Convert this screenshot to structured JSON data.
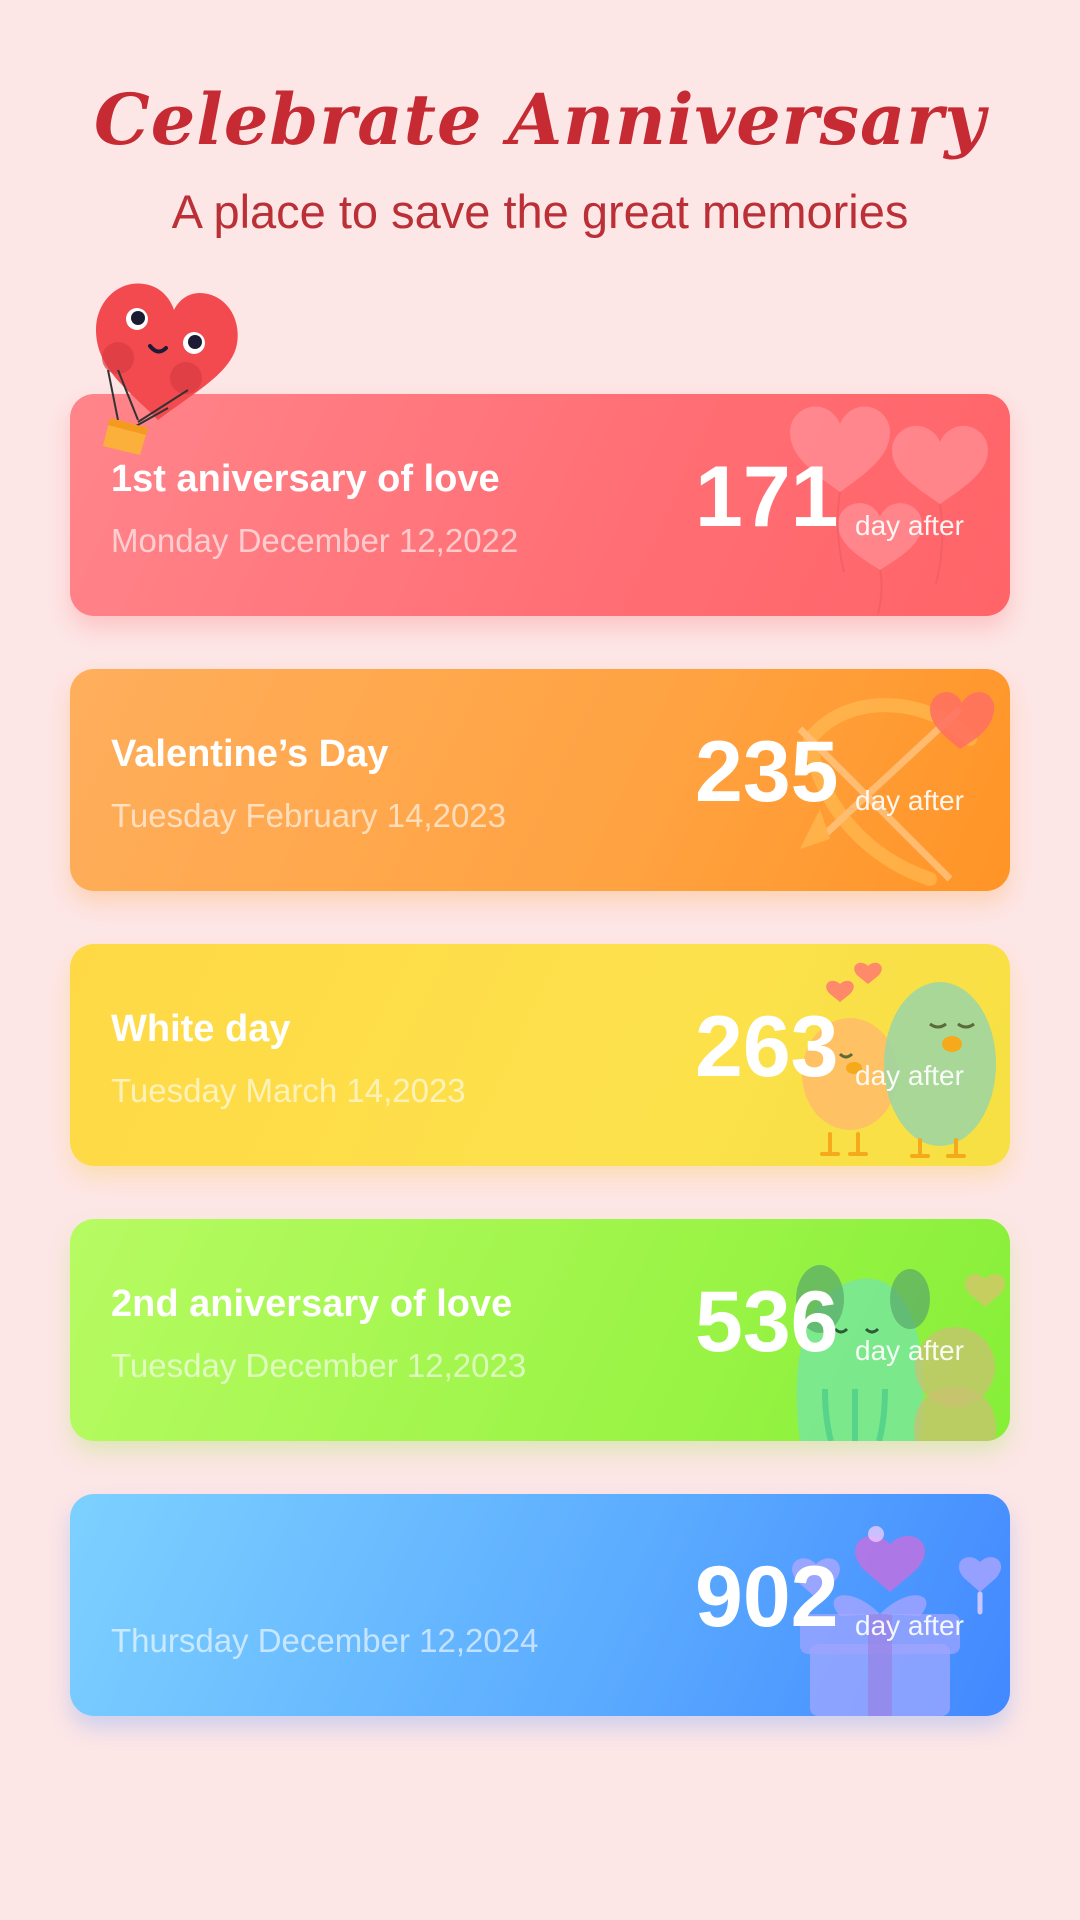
{
  "header": {
    "title": "Celebrate Anniversary",
    "subtitle": "A place to save the great memories"
  },
  "cards": [
    {
      "name": "1st aniversary of love",
      "date": "Monday December 12,2022",
      "count": "171",
      "unit": "day after",
      "icon": "heart-balloons-icon"
    },
    {
      "name": "Valentine’s Day",
      "date": "Tuesday February 14,2023",
      "count": "235",
      "unit": "day after",
      "icon": "cupid-bow-icon"
    },
    {
      "name": "White day",
      "date": "Tuesday March 14,2023",
      "count": "263",
      "unit": "day after",
      "icon": "love-birds-icon"
    },
    {
      "name": "2nd aniversary of love",
      "date": "Tuesday December 12,2023",
      "count": "536",
      "unit": "day after",
      "icon": "cute-pets-icon"
    },
    {
      "name": "",
      "date": "Thursday December 12,2024",
      "count": "902",
      "unit": "day after",
      "icon": "gift-box-icon"
    }
  ],
  "colors": {
    "background": "#fde6e6",
    "title": "#c62a33",
    "card_1": "#ff6e74",
    "card_2": "#ffa342",
    "card_3": "#fde14c",
    "card_4": "#9cf447",
    "card_5": "#5aaaff"
  }
}
